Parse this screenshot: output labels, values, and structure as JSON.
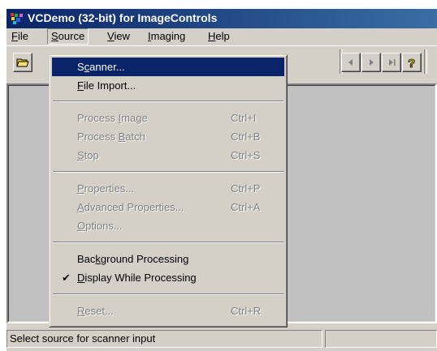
{
  "window": {
    "title": "VCDemo (32-bit) for ImageControls"
  },
  "menubar": {
    "items": [
      {
        "pre": "",
        "ul": "F",
        "post": "ile"
      },
      {
        "pre": "",
        "ul": "S",
        "post": "ource"
      },
      {
        "pre": "",
        "ul": "V",
        "post": "iew"
      },
      {
        "pre": "",
        "ul": "I",
        "post": "maging"
      },
      {
        "pre": "",
        "ul": "H",
        "post": "elp"
      }
    ]
  },
  "source_menu": {
    "items": [
      {
        "pre": "S",
        "ul": "c",
        "post": "anner...",
        "accel": ""
      },
      {
        "pre": "",
        "ul": "F",
        "post": "ile Import...",
        "accel": ""
      },
      {
        "pre": "Process ",
        "ul": "I",
        "post": "mage",
        "accel": "Ctrl+I"
      },
      {
        "pre": "Process ",
        "ul": "B",
        "post": "atch",
        "accel": "Ctrl+B"
      },
      {
        "pre": "",
        "ul": "S",
        "post": "top",
        "accel": "Ctrl+S"
      },
      {
        "pre": "",
        "ul": "P",
        "post": "roperties...",
        "accel": "Ctrl+P"
      },
      {
        "pre": "",
        "ul": "A",
        "post": "dvanced Properties...",
        "accel": "Ctrl+A"
      },
      {
        "pre": "",
        "ul": "O",
        "post": "ptions...",
        "accel": ""
      },
      {
        "pre": "Bac",
        "ul": "k",
        "post": "ground Processing",
        "accel": ""
      },
      {
        "pre": "",
        "ul": "D",
        "post": "isplay While Processing",
        "accel": "",
        "check": "✔"
      },
      {
        "pre": "",
        "ul": "R",
        "post": "eset...",
        "accel": "Ctrl+R"
      }
    ]
  },
  "statusbar": {
    "text": "Select source for scanner input"
  },
  "icons": [
    "app-icon",
    "open-folder-icon",
    "prev-page-icon",
    "next-page-icon",
    "last-page-icon",
    "help-icon"
  ]
}
